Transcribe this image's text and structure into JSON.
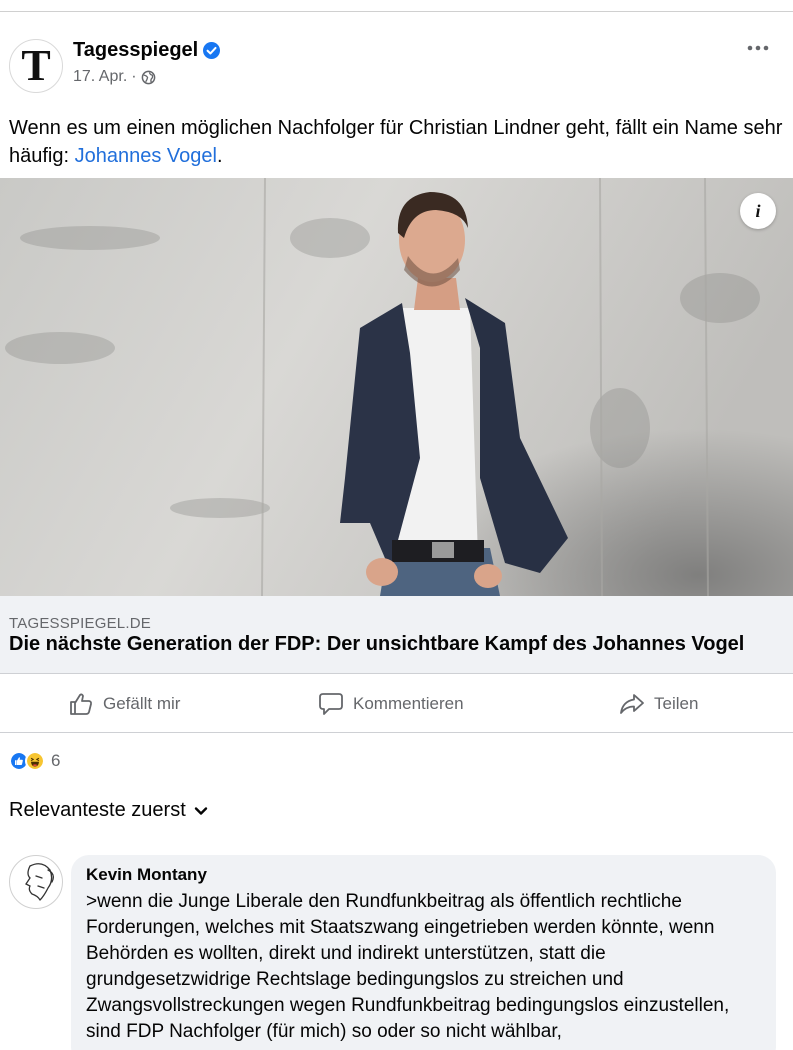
{
  "post": {
    "page_name": "Tagesspiegel",
    "page_logo_letter": "T",
    "date": "17. Apr.",
    "separator": "·",
    "text_before_link": "Wenn es um einen möglichen Nachfolger für Christian Lindner geht, fällt ein Name sehr häufig: ",
    "text_link": "Johannes Vogel",
    "text_after_link": ".",
    "more_icon": "more-horizontal-icon",
    "info_label": "i"
  },
  "link_preview": {
    "domain": "TAGESSPIEGEL.DE",
    "title": "Die nächste Generation der FDP: Der unsichtbare Kampf des Johannes Vogel"
  },
  "actions": {
    "like_label": "Gefällt mir",
    "comment_label": "Kommentieren",
    "share_label": "Teilen"
  },
  "reactions": {
    "count": "6",
    "types": [
      "like",
      "haha"
    ]
  },
  "comments": {
    "sort_label": "Relevanteste zuerst",
    "items": [
      {
        "author": "Kevin Montany",
        "text": ">wenn die Junge Liberale den Rundfunkbeitrag als öffentlich rechtliche Forderungen, welches mit Staatszwang eingetrieben werden könnte, wenn Behörden es wollten, direkt und indirekt unterstützen, statt die grundgesetzwidrige Rechtslage bedingungslos zu streichen und Zwangsvollstreckungen wegen Rundfunkbeitrag bedingungslos einzustellen, sind FDP Nachfolger (für mich) so oder so nicht wählbar,"
      }
    ]
  },
  "colors": {
    "link_blue": "#216fdb",
    "verified_blue": "#1877f2",
    "secondary_text": "#65676b",
    "bubble_bg": "#f0f2f5"
  }
}
